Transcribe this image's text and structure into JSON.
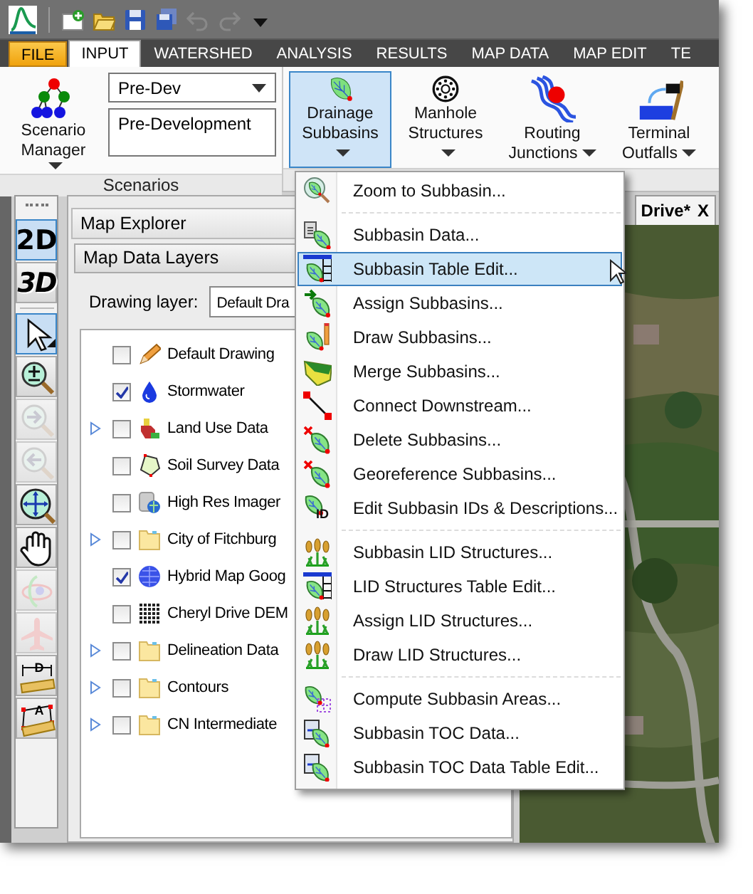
{
  "title_bar": {
    "quick_access": [
      {
        "kind": "new",
        "disabled": false
      },
      {
        "kind": "open",
        "disabled": false
      },
      {
        "kind": "save",
        "disabled": false
      },
      {
        "kind": "save-all",
        "disabled": false
      },
      {
        "kind": "undo",
        "disabled": true
      },
      {
        "kind": "redo",
        "disabled": true
      },
      {
        "kind": "customize",
        "disabled": false
      }
    ]
  },
  "ribbon_tabs": [
    {
      "label": "FILE",
      "kind": "file",
      "selected": false
    },
    {
      "label": "INPUT",
      "kind": "tab",
      "selected": true
    },
    {
      "label": "WATERSHED",
      "kind": "tab",
      "selected": false
    },
    {
      "label": "ANALYSIS",
      "kind": "tab",
      "selected": false
    },
    {
      "label": "RESULTS",
      "kind": "tab",
      "selected": false
    },
    {
      "label": "MAP DATA",
      "kind": "tab",
      "selected": false
    },
    {
      "label": "MAP EDIT",
      "kind": "tab",
      "selected": false
    },
    {
      "label": "TE",
      "kind": "tab",
      "selected": false
    }
  ],
  "scenarios": {
    "manager_button": "Scenario Manager",
    "scenario": "Pre-Dev",
    "description": "Pre-Development",
    "group_label": "Scenarios"
  },
  "input_tools": [
    {
      "kind": "subbasins",
      "label": "Drainage Subbasins",
      "selected": true
    },
    {
      "kind": "manholes",
      "label": "Manhole Structures",
      "selected": false
    },
    {
      "kind": "junctions",
      "label": "Routing Junctions",
      "selected": false
    },
    {
      "kind": "outfalls",
      "label": "Terminal Outfalls",
      "selected": false
    }
  ],
  "map_toolbar": [
    {
      "kind": "plan",
      "label": "2D",
      "selected": true,
      "disabled": false
    },
    {
      "kind": "perspective",
      "label": "3D",
      "selected": false,
      "disabled": false
    },
    {
      "kind": "select",
      "selected": true,
      "disabled": false
    },
    {
      "kind": "zoom",
      "selected": false,
      "disabled": false
    },
    {
      "kind": "zoom-next",
      "selected": false,
      "disabled": true
    },
    {
      "kind": "zoom-previous",
      "selected": false,
      "disabled": true
    },
    {
      "kind": "full-extent",
      "selected": false,
      "disabled": false
    },
    {
      "kind": "pan",
      "selected": false,
      "disabled": false
    },
    {
      "kind": "rotate",
      "selected": false,
      "disabled": true
    },
    {
      "kind": "fly",
      "selected": false,
      "disabled": true
    },
    {
      "kind": "measure-distance",
      "label": "D",
      "selected": false,
      "disabled": false
    },
    {
      "kind": "measure-area",
      "label": "A",
      "selected": false,
      "disabled": false
    }
  ],
  "map_explorer": {
    "title": "Map Explorer",
    "panel": "Map Data Layers",
    "drawing_layer_label": "Drawing layer:",
    "drawing_layer": "Default Dra",
    "layers": [
      {
        "kind": "drawing",
        "label": "Default Drawing",
        "checked": false,
        "expandable": false
      },
      {
        "kind": "water",
        "label": "Stormwater",
        "checked": true,
        "expandable": false
      },
      {
        "kind": "landuse",
        "label": "Land Use Data",
        "checked": false,
        "expandable": true
      },
      {
        "kind": "soil",
        "label": "Soil Survey Data",
        "checked": false,
        "expandable": false
      },
      {
        "kind": "imagery",
        "label": "High Res Imager",
        "checked": false,
        "expandable": false
      },
      {
        "kind": "folder",
        "label": "City of Fitchburg",
        "checked": false,
        "expandable": true
      },
      {
        "kind": "globe",
        "label": "Hybrid Map Goog",
        "checked": true,
        "expandable": false
      },
      {
        "kind": "dem",
        "label": "Cheryl Drive DEM",
        "checked": false,
        "expandable": false
      },
      {
        "kind": "folder",
        "label": "Delineation Data",
        "checked": false,
        "expandable": true
      },
      {
        "kind": "folder",
        "label": "Contours",
        "checked": false,
        "expandable": true
      },
      {
        "kind": "folder",
        "label": "CN Intermediate",
        "checked": false,
        "expandable": true
      }
    ]
  },
  "map_view": {
    "tab": "Drive*",
    "close": "X",
    "kind": "picture"
  },
  "menu": {
    "groups": [
      [
        {
          "kind": "zoom",
          "label": "Zoom to Subbasin...",
          "selected": false
        }
      ],
      [
        {
          "kind": "data",
          "label": "Subbasin Data...",
          "selected": false
        },
        {
          "kind": "table",
          "label": "Subbasin Table Edit...",
          "selected": true
        },
        {
          "kind": "assign",
          "label": "Assign Subbasins...",
          "selected": false
        },
        {
          "kind": "draw",
          "label": "Draw Subbasins...",
          "selected": false
        },
        {
          "kind": "merge",
          "label": "Merge Subbasins...",
          "selected": false
        },
        {
          "kind": "connect",
          "label": "Connect Downstream...",
          "selected": false
        },
        {
          "kind": "delete",
          "label": "Delete Subbasins...",
          "selected": false
        },
        {
          "kind": "delete",
          "label": "Georeference Subbasins...",
          "selected": false
        },
        {
          "kind": "ids",
          "label": "Edit Subbasin IDs & Descriptions...",
          "badge": "ID",
          "selected": false
        }
      ],
      [
        {
          "kind": "lid",
          "label": "Subbasin LID Structures...",
          "selected": false
        },
        {
          "kind": "table",
          "label": "LID Structures Table Edit...",
          "selected": false
        },
        {
          "kind": "lid",
          "label": "Assign LID Structures...",
          "selected": false
        },
        {
          "kind": "lid",
          "label": "Draw LID Structures...",
          "selected": false
        }
      ],
      [
        {
          "kind": "compute",
          "label": "Compute Subbasin Areas...",
          "selected": false
        },
        {
          "kind": "toc",
          "label": "Subbasin TOC Data...",
          "selected": false
        },
        {
          "kind": "toc",
          "label": "Subbasin TOC Data Table Edit...",
          "selected": false
        }
      ]
    ]
  }
}
